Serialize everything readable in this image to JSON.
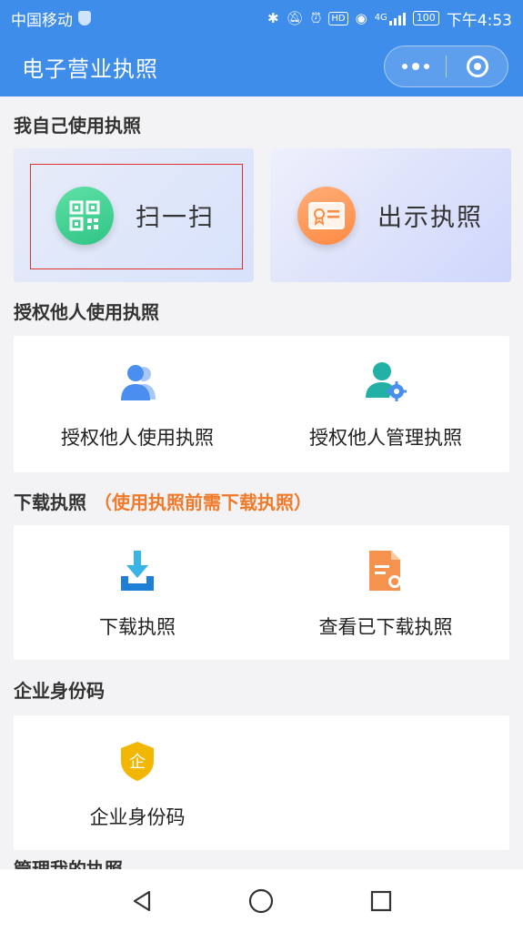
{
  "status_bar": {
    "carrier": "中国移动",
    "network": "4G",
    "battery": "100",
    "time": "下午4:53"
  },
  "title_bar": {
    "title": "电子营业执照",
    "more_icon": "more-dots-icon",
    "close_icon": "target-ring-icon"
  },
  "sections": {
    "self_use": {
      "title": "我自己使用执照",
      "scan": {
        "label": "扫一扫",
        "icon": "qr-code-icon"
      },
      "show": {
        "label": "出示执照",
        "icon": "license-card-icon"
      }
    },
    "authorize": {
      "title": "授权他人使用执照",
      "items": [
        {
          "label": "授权他人使用执照",
          "icon": "users-icon"
        },
        {
          "label": "授权他人管理执照",
          "icon": "user-settings-icon"
        }
      ]
    },
    "download": {
      "title": "下载执照",
      "note": "（使用执照前需下载执照）",
      "items": [
        {
          "label": "下载执照",
          "icon": "download-icon"
        },
        {
          "label": "查看已下载执照",
          "icon": "document-icon"
        }
      ]
    },
    "enterprise_id": {
      "title": "企业身份码",
      "items": [
        {
          "label": "企业身份码",
          "icon": "enterprise-shield-icon",
          "badge_char": "企"
        }
      ]
    },
    "manage": {
      "title": "管理我的执照"
    }
  },
  "colors": {
    "header_blue": "#3f8dea",
    "accent_orange": "#f07a2a",
    "scan_green": "#2fc585",
    "show_orange": "#ff8a43",
    "highlight_red": "#e23030"
  },
  "nav": {
    "back_icon": "back-triangle-icon",
    "home_icon": "home-circle-icon",
    "recent_icon": "recent-square-icon"
  }
}
